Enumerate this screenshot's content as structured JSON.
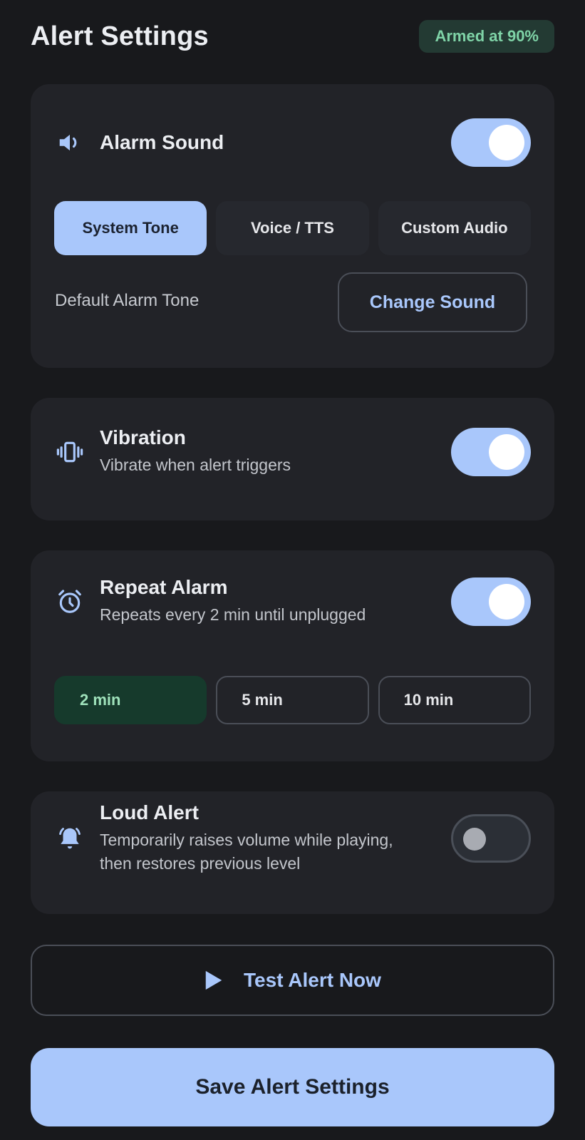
{
  "header": {
    "title": "Alert Settings",
    "status_badge": "Armed at 90%"
  },
  "alarm_sound": {
    "title": "Alarm Sound",
    "icon": "speaker-icon",
    "enabled": true,
    "options": [
      {
        "label": "System Tone",
        "selected": true
      },
      {
        "label": "Voice / TTS",
        "selected": false
      },
      {
        "label": "Custom Audio",
        "selected": false
      }
    ],
    "current_tone": "Default Alarm Tone",
    "change_button": "Change Sound"
  },
  "vibration": {
    "title": "Vibration",
    "subtitle": "Vibrate when alert triggers",
    "icon": "vibration-icon",
    "enabled": true
  },
  "repeat_alarm": {
    "title": "Repeat Alarm",
    "subtitle": "Repeats every 2 min until unplugged",
    "icon": "alarm-clock-icon",
    "enabled": true,
    "intervals": [
      {
        "label": "2 min",
        "selected": true
      },
      {
        "label": "5 min",
        "selected": false
      },
      {
        "label": "10 min",
        "selected": false
      }
    ]
  },
  "loud_alert": {
    "title": "Loud Alert",
    "subtitle_line1": "Temporarily raises volume while playing,",
    "subtitle_line2": "then restores previous level",
    "icon": "bell-ringing-icon",
    "enabled": false
  },
  "actions": {
    "test_label": "Test Alert Now",
    "test_icon": "play-icon",
    "save_label": "Save Alert Settings"
  },
  "colors": {
    "accent": "#a9c7fb",
    "background": "#18191c",
    "card": "#222328",
    "badge_bg": "#233a33",
    "badge_text": "#7fd3a7",
    "selected_interval_bg": "#163a2c"
  }
}
